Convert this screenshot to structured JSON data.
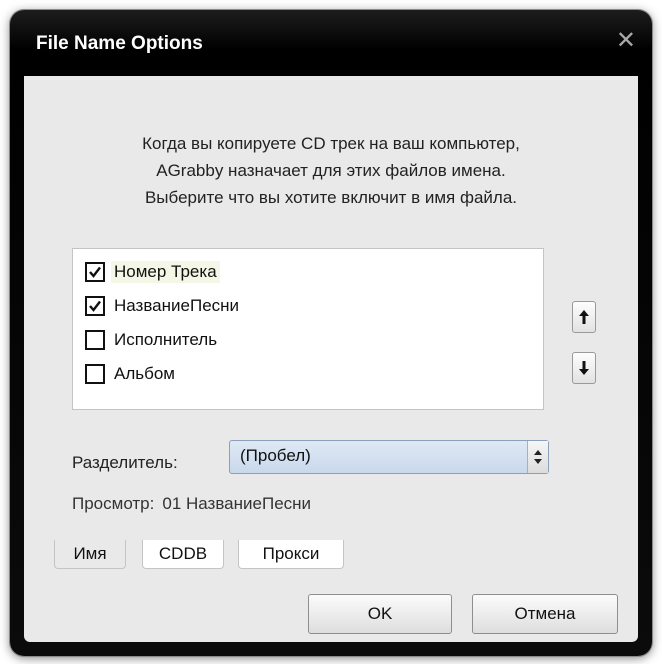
{
  "window": {
    "title": "File Name Options",
    "close_glyph": "✕"
  },
  "info": {
    "line1": "Когда вы копируете CD трек на ваш компьютер,",
    "line2": "AGrabby назначает для этих файлов имена.",
    "line3": "Выберите что вы хотите включит в имя файла."
  },
  "fields": [
    {
      "label": "Номер Трека",
      "checked": true
    },
    {
      "label": "НазваниеПесни",
      "checked": true
    },
    {
      "label": "Исполнитель",
      "checked": false
    },
    {
      "label": "Альбом",
      "checked": false
    }
  ],
  "move": {
    "up_icon": "arrow-up-icon",
    "down_icon": "arrow-down-icon"
  },
  "separator": {
    "label": "Разделитель:",
    "value": "(Пробел)"
  },
  "preview": {
    "label": "Просмотр:",
    "value": "01 НазваниеПесни"
  },
  "tabs": [
    {
      "label": "Имя",
      "active": true
    },
    {
      "label": "CDDB",
      "active": false
    },
    {
      "label": "Прокси",
      "active": false
    }
  ],
  "buttons": {
    "ok": "OK",
    "cancel": "Отмена"
  },
  "colors": {
    "titlebar": "#000000",
    "client": "#e9e9e9",
    "select": "#c9d8ec"
  }
}
